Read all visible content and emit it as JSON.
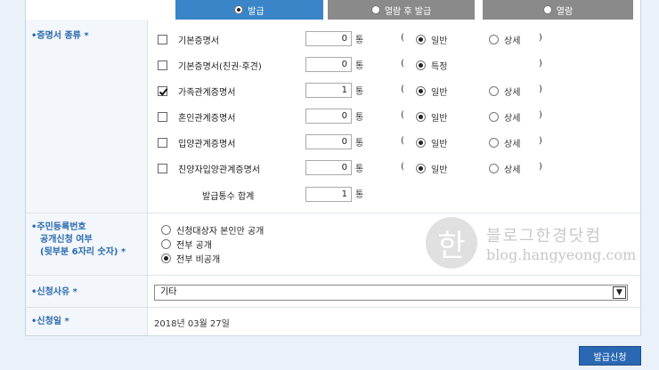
{
  "tabs": [
    {
      "label": "발급",
      "selected": true
    },
    {
      "label": "열람 후 발급",
      "selected": false
    },
    {
      "label": "열람",
      "selected": false
    }
  ],
  "section_doc": {
    "label": "•증명서 종류 *"
  },
  "docs": [
    {
      "name": "기본증명서",
      "checked": false,
      "qty": "0",
      "unit": "통",
      "opt1": "일반",
      "opt2": "상세",
      "sel": 1
    },
    {
      "name": "기본증명서(친권·후견)",
      "checked": false,
      "qty": "0",
      "unit": "통",
      "opt1": "특정",
      "opt2": "",
      "sel": 1
    },
    {
      "name": "가족관계증명서",
      "checked": true,
      "qty": "1",
      "unit": "통",
      "opt1": "일반",
      "opt2": "상세",
      "sel": 1
    },
    {
      "name": "혼인관계증명서",
      "checked": false,
      "qty": "0",
      "unit": "통",
      "opt1": "일반",
      "opt2": "상세",
      "sel": 1
    },
    {
      "name": "입양관계증명서",
      "checked": false,
      "qty": "0",
      "unit": "통",
      "opt1": "일반",
      "opt2": "상세",
      "sel": 1
    },
    {
      "name": "친양자입양관계증명서",
      "checked": false,
      "qty": "0",
      "unit": "통",
      "opt1": "일반",
      "opt2": "상세",
      "sel": 1
    }
  ],
  "paren_open": "(",
  "paren_close": ")",
  "total": {
    "label": "발급통수 합계",
    "qty": "1",
    "unit": "통"
  },
  "section_id": {
    "label_lines": [
      "•주민등록번호",
      "공개신청 여부",
      "(뒷부분 6자리 숫자) *"
    ]
  },
  "id_options": [
    {
      "label": "신청대상자 본인만 공개",
      "selected": false
    },
    {
      "label": "전부 공개",
      "selected": false
    },
    {
      "label": "전부 비공개",
      "selected": true
    }
  ],
  "section_reason": {
    "label": "•신청사유 *",
    "value": "기타"
  },
  "section_date": {
    "label": "•신청일 *",
    "value": "2018년 03월 27일"
  },
  "submit_label": "발급신청",
  "watermark": {
    "logo": "한",
    "text_kor": "블로그한경닷컴",
    "url": "blog.hangyeong.com"
  }
}
